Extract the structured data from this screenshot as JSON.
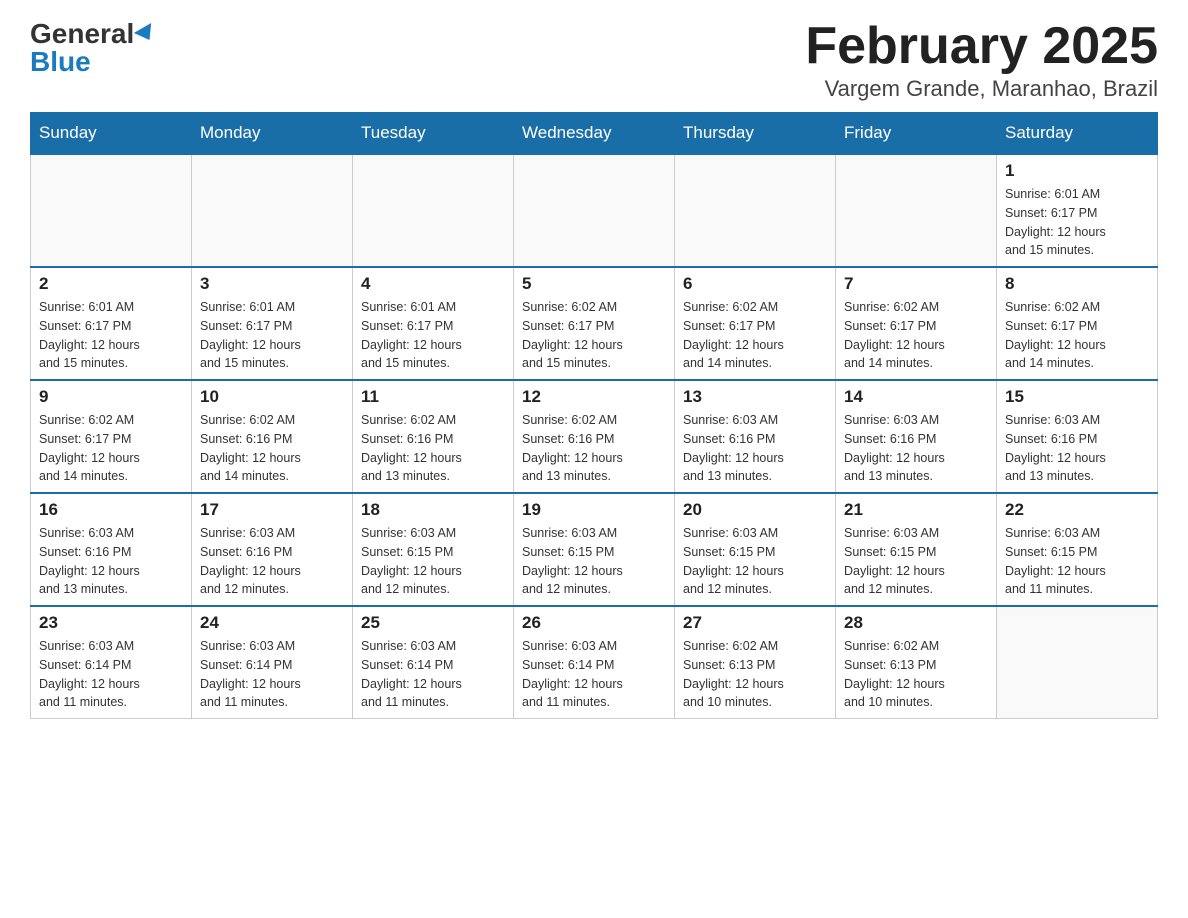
{
  "header": {
    "logo_general": "General",
    "logo_blue": "Blue",
    "month_title": "February 2025",
    "location": "Vargem Grande, Maranhao, Brazil"
  },
  "weekdays": [
    "Sunday",
    "Monday",
    "Tuesday",
    "Wednesday",
    "Thursday",
    "Friday",
    "Saturday"
  ],
  "weeks": [
    [
      {
        "day": "",
        "info": ""
      },
      {
        "day": "",
        "info": ""
      },
      {
        "day": "",
        "info": ""
      },
      {
        "day": "",
        "info": ""
      },
      {
        "day": "",
        "info": ""
      },
      {
        "day": "",
        "info": ""
      },
      {
        "day": "1",
        "info": "Sunrise: 6:01 AM\nSunset: 6:17 PM\nDaylight: 12 hours\nand 15 minutes."
      }
    ],
    [
      {
        "day": "2",
        "info": "Sunrise: 6:01 AM\nSunset: 6:17 PM\nDaylight: 12 hours\nand 15 minutes."
      },
      {
        "day": "3",
        "info": "Sunrise: 6:01 AM\nSunset: 6:17 PM\nDaylight: 12 hours\nand 15 minutes."
      },
      {
        "day": "4",
        "info": "Sunrise: 6:01 AM\nSunset: 6:17 PM\nDaylight: 12 hours\nand 15 minutes."
      },
      {
        "day": "5",
        "info": "Sunrise: 6:02 AM\nSunset: 6:17 PM\nDaylight: 12 hours\nand 15 minutes."
      },
      {
        "day": "6",
        "info": "Sunrise: 6:02 AM\nSunset: 6:17 PM\nDaylight: 12 hours\nand 14 minutes."
      },
      {
        "day": "7",
        "info": "Sunrise: 6:02 AM\nSunset: 6:17 PM\nDaylight: 12 hours\nand 14 minutes."
      },
      {
        "day": "8",
        "info": "Sunrise: 6:02 AM\nSunset: 6:17 PM\nDaylight: 12 hours\nand 14 minutes."
      }
    ],
    [
      {
        "day": "9",
        "info": "Sunrise: 6:02 AM\nSunset: 6:17 PM\nDaylight: 12 hours\nand 14 minutes."
      },
      {
        "day": "10",
        "info": "Sunrise: 6:02 AM\nSunset: 6:16 PM\nDaylight: 12 hours\nand 14 minutes."
      },
      {
        "day": "11",
        "info": "Sunrise: 6:02 AM\nSunset: 6:16 PM\nDaylight: 12 hours\nand 13 minutes."
      },
      {
        "day": "12",
        "info": "Sunrise: 6:02 AM\nSunset: 6:16 PM\nDaylight: 12 hours\nand 13 minutes."
      },
      {
        "day": "13",
        "info": "Sunrise: 6:03 AM\nSunset: 6:16 PM\nDaylight: 12 hours\nand 13 minutes."
      },
      {
        "day": "14",
        "info": "Sunrise: 6:03 AM\nSunset: 6:16 PM\nDaylight: 12 hours\nand 13 minutes."
      },
      {
        "day": "15",
        "info": "Sunrise: 6:03 AM\nSunset: 6:16 PM\nDaylight: 12 hours\nand 13 minutes."
      }
    ],
    [
      {
        "day": "16",
        "info": "Sunrise: 6:03 AM\nSunset: 6:16 PM\nDaylight: 12 hours\nand 13 minutes."
      },
      {
        "day": "17",
        "info": "Sunrise: 6:03 AM\nSunset: 6:16 PM\nDaylight: 12 hours\nand 12 minutes."
      },
      {
        "day": "18",
        "info": "Sunrise: 6:03 AM\nSunset: 6:15 PM\nDaylight: 12 hours\nand 12 minutes."
      },
      {
        "day": "19",
        "info": "Sunrise: 6:03 AM\nSunset: 6:15 PM\nDaylight: 12 hours\nand 12 minutes."
      },
      {
        "day": "20",
        "info": "Sunrise: 6:03 AM\nSunset: 6:15 PM\nDaylight: 12 hours\nand 12 minutes."
      },
      {
        "day": "21",
        "info": "Sunrise: 6:03 AM\nSunset: 6:15 PM\nDaylight: 12 hours\nand 12 minutes."
      },
      {
        "day": "22",
        "info": "Sunrise: 6:03 AM\nSunset: 6:15 PM\nDaylight: 12 hours\nand 11 minutes."
      }
    ],
    [
      {
        "day": "23",
        "info": "Sunrise: 6:03 AM\nSunset: 6:14 PM\nDaylight: 12 hours\nand 11 minutes."
      },
      {
        "day": "24",
        "info": "Sunrise: 6:03 AM\nSunset: 6:14 PM\nDaylight: 12 hours\nand 11 minutes."
      },
      {
        "day": "25",
        "info": "Sunrise: 6:03 AM\nSunset: 6:14 PM\nDaylight: 12 hours\nand 11 minutes."
      },
      {
        "day": "26",
        "info": "Sunrise: 6:03 AM\nSunset: 6:14 PM\nDaylight: 12 hours\nand 11 minutes."
      },
      {
        "day": "27",
        "info": "Sunrise: 6:02 AM\nSunset: 6:13 PM\nDaylight: 12 hours\nand 10 minutes."
      },
      {
        "day": "28",
        "info": "Sunrise: 6:02 AM\nSunset: 6:13 PM\nDaylight: 12 hours\nand 10 minutes."
      },
      {
        "day": "",
        "info": ""
      }
    ]
  ]
}
